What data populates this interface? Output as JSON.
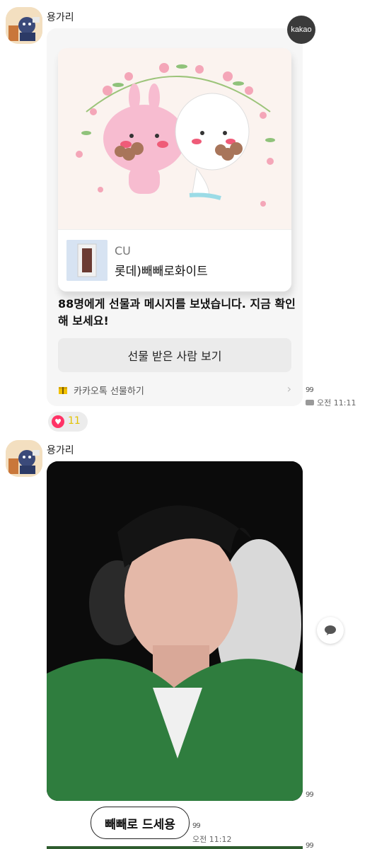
{
  "messages": {
    "first": {
      "sender": "용가리",
      "gift": {
        "badge": "kakao",
        "brand": "CU",
        "product": "롯데)빼빼로화이트",
        "text": "88명에게 선물과 메시지를 보냈습니다. 지금 확인해 보세요!",
        "button": "선물 받은 사람 보기",
        "footer": "카카오톡 선물하기"
      },
      "read": "99",
      "time": "오전 11:11",
      "reaction_count": "11"
    },
    "second": {
      "sender": "용가리",
      "photo_read": "99",
      "bubble": "빼빼로 드세용",
      "bubble_read": "99",
      "time": "오전 11:12",
      "bottom_read": "99"
    }
  },
  "colors": {
    "reaction_heart": "#ff3366",
    "button_bg": "#ebebeb",
    "card_bg": "#f6f6f6"
  }
}
